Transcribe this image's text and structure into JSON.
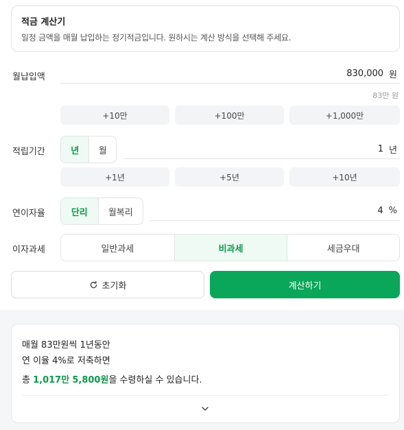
{
  "info": {
    "title": "적금 계산기",
    "description": "일정 금액을 매월 납입하는 정기적금입니다. 원하시는 계산 방식을 선택해 주세요."
  },
  "monthly": {
    "label": "월납입액",
    "value": "830,000",
    "unit": "원",
    "hint": "83만 원",
    "chips": [
      "+10만",
      "+100만",
      "+1,000만"
    ]
  },
  "period": {
    "label": "적립기간",
    "units": [
      "년",
      "월"
    ],
    "selected_unit": "년",
    "value": "1",
    "unit": "년",
    "chips": [
      "+1년",
      "+5년",
      "+10년"
    ]
  },
  "rate": {
    "label": "연이자율",
    "types": [
      "단리",
      "월복리"
    ],
    "selected_type": "단리",
    "value": "4",
    "unit": "%"
  },
  "tax": {
    "label": "이자과세",
    "options": [
      "일반과세",
      "비과세",
      "세금우대"
    ],
    "selected": "비과세"
  },
  "actions": {
    "reset_label": "초기화",
    "calc_label": "계산하기"
  },
  "result": {
    "line1": "매월 83만원씩 1년동안",
    "line2": "연 이율 4%로 저축하면",
    "prefix": "총",
    "amount_man": "1,017만",
    "amount_won": "5,800원",
    "suffix": "을 수령하실 수 있습니다."
  },
  "colors": {
    "accent": "#0aa65a",
    "accent_text": "#0a9a4a",
    "active_bg": "#eefaf3"
  }
}
